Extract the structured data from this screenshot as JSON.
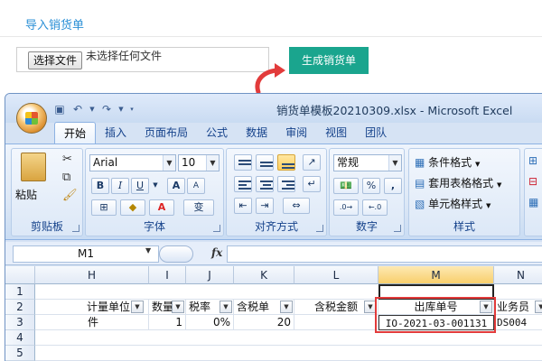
{
  "page": {
    "title": "导入销货单",
    "file_button": "选择文件",
    "file_status": "未选择任何文件",
    "generate_button": "生成销货单"
  },
  "excel": {
    "window_title": "销货单模板20210309.xlsx - Microsoft Excel",
    "tabs": [
      "开始",
      "插入",
      "页面布局",
      "公式",
      "数据",
      "审阅",
      "视图",
      "团队"
    ],
    "active_tab": "开始",
    "groups": {
      "clipboard": {
        "label": "剪贴板",
        "paste": "粘贴"
      },
      "font": {
        "label": "字体",
        "font_name": "Arial",
        "font_size": "10",
        "bold": "B",
        "italic": "I",
        "underline": "U",
        "grow": "A",
        "shrink": "A",
        "wen": "变"
      },
      "alignment": {
        "label": "对齐方式"
      },
      "number": {
        "label": "数字",
        "format": "常规",
        "percent": "%",
        "comma": ","
      },
      "styles": {
        "label": "样式",
        "conditional": "条件格式",
        "table_format": "套用表格格式",
        "cell_styles": "单元格样式"
      }
    },
    "formula_bar": {
      "name_box": "M1",
      "fx": "fx",
      "content": ""
    },
    "columns": [
      "H",
      "I",
      "J",
      "K",
      "L",
      "M",
      "N"
    ],
    "selected_column": "M",
    "rows": [
      "1",
      "2",
      "3",
      "4",
      "5"
    ],
    "headers_row2": [
      "计量单位",
      "数量",
      "税率",
      "含税单",
      "含税金额",
      "出库单号",
      "业务员"
    ],
    "data_row3": [
      "件",
      "1",
      "0%",
      "20",
      "",
      "IO-2021-03-001131",
      "DS004"
    ]
  },
  "colors": {
    "accent_button": "#1aa58e",
    "link_title": "#2a8fd6",
    "highlight_box": "#e23b3b",
    "arrow": "#e23b3b"
  }
}
